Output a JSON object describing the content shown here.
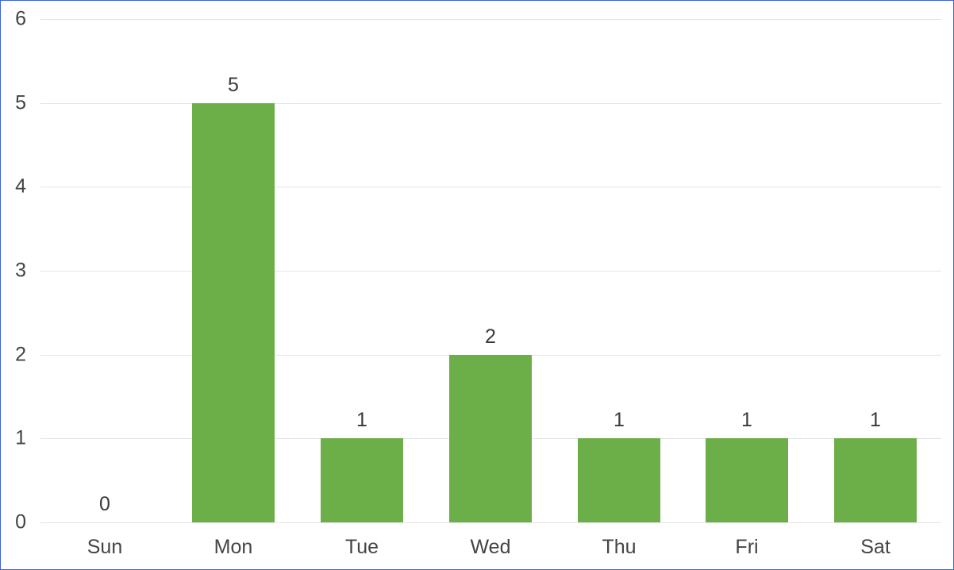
{
  "chart_data": {
    "type": "bar",
    "title": "",
    "subtitle": "",
    "xlabel": "",
    "ylabel": "",
    "categories": [
      "Sun",
      "Mon",
      "Tue",
      "Wed",
      "Thu",
      "Fri",
      "Sat"
    ],
    "values": [
      0,
      5,
      1,
      2,
      1,
      1,
      1
    ],
    "data_labels": [
      "0",
      "5",
      "1",
      "2",
      "1",
      "1",
      "1"
    ],
    "ylim": [
      0,
      6
    ],
    "ytick_labels": [
      "0",
      "1",
      "2",
      "3",
      "4",
      "5",
      "6"
    ],
    "yticks": [
      0,
      1,
      2,
      3,
      4,
      5,
      6
    ],
    "grid": true,
    "grid_axis": "y",
    "legend": false,
    "legend_position": "none",
    "series": [
      {
        "name": "",
        "values": [
          0,
          5,
          1,
          2,
          1,
          1,
          1
        ],
        "color": "#6CAE47"
      }
    ]
  },
  "style": {
    "bar_color": "#6CAE47",
    "gridline_color": "#e4e4e4",
    "axis_text_color": "#444444",
    "label_text_color": "#3a3a3a",
    "border_color": "#3b64e3",
    "background_color": "#ffffff"
  }
}
